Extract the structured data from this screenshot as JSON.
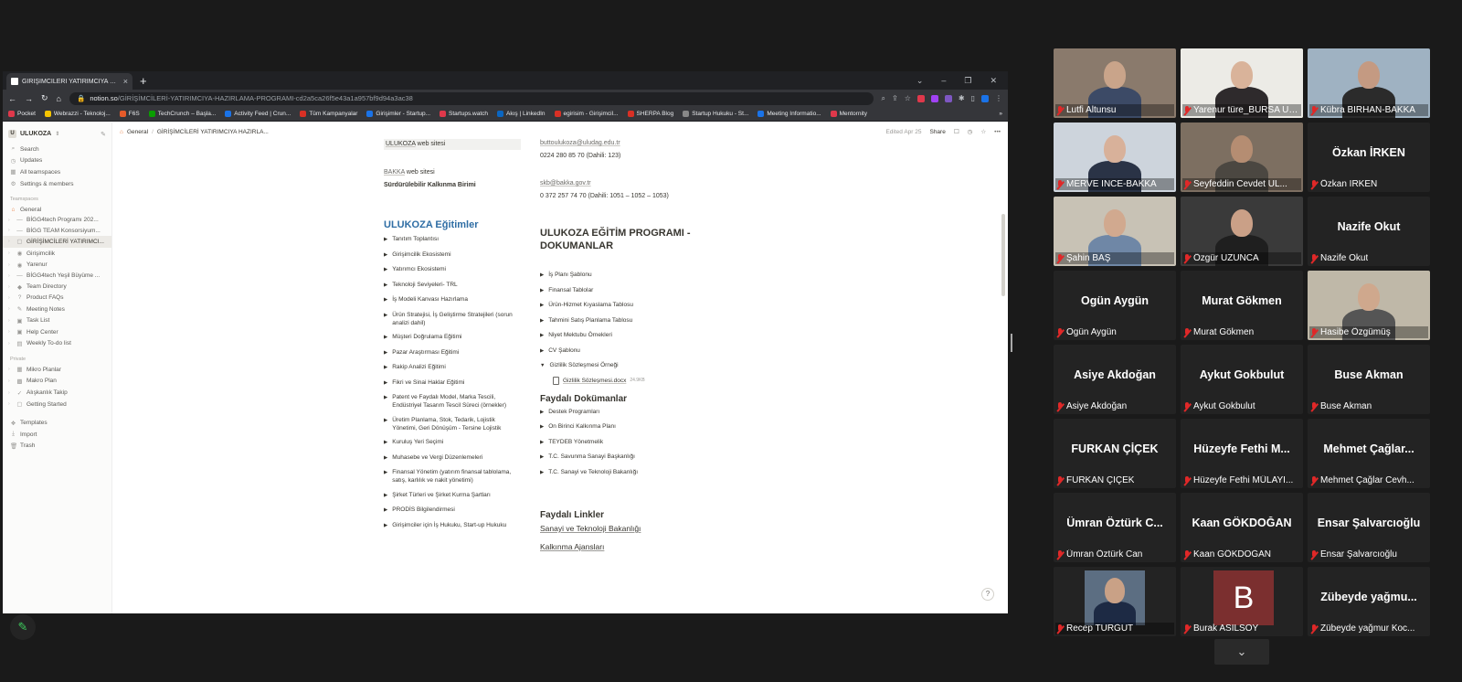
{
  "browser": {
    "tab_title": "GİRİŞİMCİLERİ YATIRIMCIYA HAZ",
    "tab_close": "×",
    "new_tab": "+",
    "url_host": "notion.so",
    "url_path": "/GİRİŞİMCİLERİ-YATIRIMCIYA-HAZIRLAMA-PROGRAMI-cd2a5ca26f5e43a1a957bf9d94a3ac38",
    "bookmarks": [
      {
        "label": "Pocket",
        "color": "#e0384b"
      },
      {
        "label": "Webrazzi - Teknoloj...",
        "color": "#f5c400"
      },
      {
        "label": "F6S",
        "color": "#e65b2a"
      },
      {
        "label": "TechCrunch – Başla...",
        "color": "#0a9e01"
      },
      {
        "label": "Activity Feed | Crun...",
        "color": "#1a73e8"
      },
      {
        "label": "Tüm Kampanyalar",
        "color": "#d93025"
      },
      {
        "label": "Girişimler - Startup...",
        "color": "#1a73e8"
      },
      {
        "label": "Startups.watch",
        "color": "#e0384b"
      },
      {
        "label": "Akış | LinkedIn",
        "color": "#0a66c2"
      },
      {
        "label": "egirisim - Girişimcil...",
        "color": "#d93025"
      },
      {
        "label": "SHERPA Blog",
        "color": "#d93025"
      },
      {
        "label": "Startup Hukuku - St...",
        "color": "#888888"
      },
      {
        "label": "Meeting Informatio...",
        "color": "#1a73e8"
      },
      {
        "label": "Mentornity",
        "color": "#e0384b"
      }
    ]
  },
  "sidebar": {
    "workspace": "ULUKOZA",
    "top_items": [
      "Search",
      "Updates",
      "All teamspaces",
      "Settings & members"
    ],
    "teamspaces_label": "Teamspaces",
    "general_label": "General",
    "pages": [
      "BİGG4tech Programı 202...",
      "BİGG TEAM Konsorsiyum...",
      "GİRİŞİMCİLERİ YATIRIMCI...",
      "Girişimcilik",
      "Yarenur",
      "BİGG4tech Yeşil Büyüme ...",
      "Team Directory",
      "Product FAQs",
      "Meeting Notes",
      "Task List",
      "Help Center",
      "Weekly To-do list"
    ],
    "private_label": "Private",
    "private_pages": [
      "Mikro Planlar",
      "Makro Plan",
      "Alışkanlık Takip",
      "Getting Started"
    ],
    "bottom_items": [
      "Templates",
      "Import",
      "Trash"
    ]
  },
  "topbar": {
    "crumb1": "General",
    "sep": "/",
    "crumb2": "GİRİŞİMCİLERİ YATIRIMCIYA HAZIRLA...",
    "edited": "Edited Apr 25",
    "share": "Share"
  },
  "content": {
    "left": {
      "site1_link": "ULUKOZA",
      "site1_rest": " web sitesi",
      "site2_link": "BAKKA",
      "site2_rest": " web sitesi",
      "unit": "Sürdürülebilir Kalkınma Birimi",
      "heading": "ULUKOZA Eğitimler",
      "trainings": [
        "Tanıtım Toplantısı",
        "Girişimcilik Ekosistemi",
        "Yatırımcı Ekosistemi",
        "Teknoloji Seviyeleri- TRL",
        "İş Modeli Kanvası Hazırlama",
        "Ürün Stratejisi, İş Geliştirme Stratejileri (sorun analizi dahil)",
        "Müşteri Doğrulama Eğitimi",
        "Pazar Araştırması Eğitimi",
        "Rakip Analizi Eğitimi",
        "Fikri ve Sinai Haklar Eğitimi",
        "Patent ve Faydalı Model, Marka Tescili, Endüstriyel Tasarım Tescil Süreci (örnekler)",
        "Üretim Planlama, Stok, Tedarik, Lojistik Yönetimi, Geri Dönüşüm - Tersine Lojistik",
        "Kuruluş Yeri Seçimi",
        "Muhasebe ve Vergi Düzenlemeleri",
        "Finansal Yönetim (yatırım finansal tablolama, satış, karlılık ve nakit yönetimi)",
        "Şirket Türleri ve Şirket Kurma Şartları",
        "PRODİS Bilgilendirmesi",
        "Girişimciler için İş Hukuku, Start-up Hukuku"
      ]
    },
    "right": {
      "email1": "buttoulukoza@uludag.edu.tr",
      "phone1": "0224 280 85 70 (Dahili: 123)",
      "email2": "skb@bakka.gov.tr",
      "phone2": "0 372 257 74 70 (Dahili: 1051 – 1052 – 1053)",
      "heading1": "ULUKOZA EĞİTİM PROGRAMI - DOKUMANLAR",
      "docs": [
        "İş Planı Şablonu",
        "Finansal Tablolar",
        "Ürün-Hizmet Kıyaslama Tablosu",
        "Tahmini Satış Planlama Tablosu",
        "Niyet Mektubu Örnekleri",
        "CV Şablonu",
        "Gizlilik Sözleşmesi Örneği"
      ],
      "file_name": "Gizlilik Sözleşmesi.docx",
      "file_size": "24.9KB",
      "heading2": "Faydalı Dokümanlar",
      "useful_docs": [
        "Destek Programları",
        "On Birinci Kalkınma Planı",
        "TEYDEB Yönetmelik",
        "T.C. Savunma Sanayi Başkanlığı",
        "T.C. Sanayi ve Teknoloji Bakanlığı"
      ],
      "heading3": "Faydalı Linkler",
      "links": [
        "Sanayi ve Teknoloji Bakanlığı",
        "Kalkınma Ajansları"
      ]
    },
    "help": "?"
  },
  "participants": [
    {
      "name": "Lutfi Altunsu",
      "video": true,
      "bg": "#8a7a6c",
      "skin": "#c9a48a",
      "shirt": "#3c4a66"
    },
    {
      "name": "Yarenur türe_BURSA ULU...",
      "video": true,
      "bg": "#ecebe6",
      "skin": "#d9b39a",
      "shirt": "#2e2a2c",
      "speaker": true
    },
    {
      "name": "Kübra BİRHAN-BAKKA",
      "video": true,
      "bg": "#9fb2c2",
      "skin": "#c49a82",
      "shirt": "#2b2b2b"
    },
    {
      "name": "MERVE İNCE-BAKKA",
      "video": true,
      "bg": "#cdd4dc",
      "skin": "#d8b19a",
      "shirt": "#2a3346"
    },
    {
      "name": "Seyfeddin Cevdet UL...",
      "video": true,
      "bg": "#7d6f61",
      "skin": "#b58d72",
      "shirt": "#4b4741"
    },
    {
      "name": "Özkan İRKEN",
      "video": false,
      "big": "Özkan İRKEN"
    },
    {
      "name": "Şahin BAŞ",
      "video": true,
      "bg": "#c8c2b5",
      "skin": "#d1a98f",
      "shirt": "#6f87a6"
    },
    {
      "name": "Özgür UZUNCA",
      "video": true,
      "bg": "#3a3a3a",
      "skin": "#caa087",
      "shirt": "#1f1f1f"
    },
    {
      "name": "Nazife Okut",
      "video": false,
      "big": "Nazife Okut"
    },
    {
      "name": "Ogün Aygün",
      "video": false,
      "big": "Ogün Aygün"
    },
    {
      "name": "Murat Gökmen",
      "video": false,
      "big": "Murat Gökmen"
    },
    {
      "name": "Hasibe Özgümüş",
      "video": true,
      "bg": "#bfb8a8",
      "skin": "#cfa88d",
      "shirt": "#555555"
    },
    {
      "name": "Asiye Akdoğan",
      "video": false,
      "big": "Asiye Akdoğan"
    },
    {
      "name": "Aykut Gokbulut",
      "video": false,
      "big": "Aykut Gokbulut"
    },
    {
      "name": "Buse Akman",
      "video": false,
      "big": "Buse Akman"
    },
    {
      "name": "FURKAN ÇİÇEK",
      "video": false,
      "big": "FURKAN ÇİÇEK"
    },
    {
      "name": "Hüzeyfe Fethi MÜLAYİ...",
      "video": false,
      "big": "Hüzeyfe Fethi M..."
    },
    {
      "name": "Mehmet Çağlar Cevh...",
      "video": false,
      "big": "Mehmet  Çağlar..."
    },
    {
      "name": "Ümran Öztürk Can",
      "video": false,
      "big": "Ümran  Öztürk  C..."
    },
    {
      "name": "Kaan GÖKDOĞAN",
      "video": false,
      "big": "Kaan GÖKDOĞAN"
    },
    {
      "name": "Ensar Şalvarcıoğlu",
      "video": false,
      "big": "Ensar Şalvarcıoğlu"
    },
    {
      "name": "Recep TURĞUT",
      "video": true,
      "bg": "#2a2a2a",
      "skin": "#c9a186",
      "shirt": "#1d2a44",
      "pic": true
    },
    {
      "name": "Burak ASILSOY",
      "video": false,
      "avatar": "B"
    },
    {
      "name": "Zübeyde yağmur Koc...",
      "video": false,
      "big": "Zübeyde  yağmu..."
    }
  ],
  "grid_more": "⌄"
}
